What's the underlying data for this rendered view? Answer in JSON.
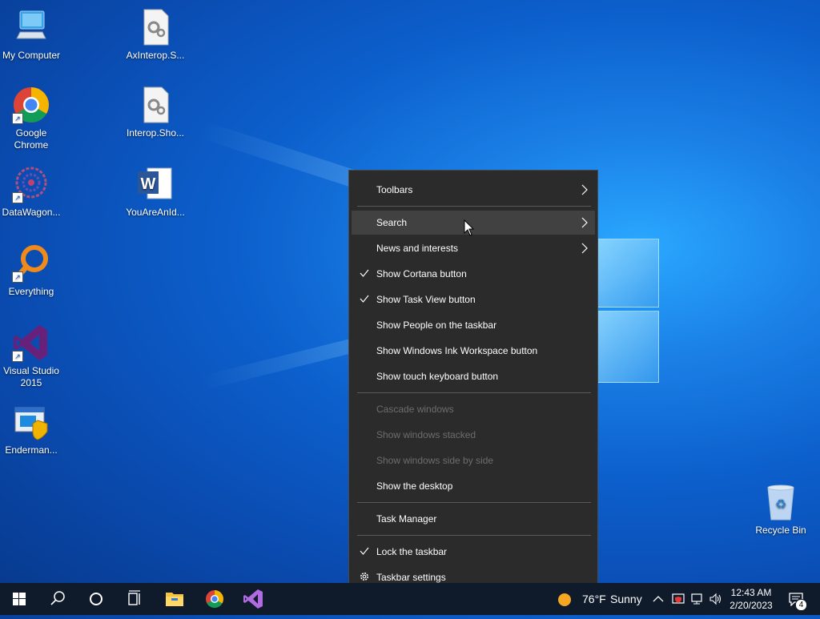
{
  "desktop": {
    "icons": [
      {
        "label": "My Computer",
        "icon": "computer-icon"
      },
      {
        "label": "AxInterop.S...",
        "icon": "dll-file-icon"
      },
      {
        "label": "Google Chrome",
        "icon": "chrome-icon"
      },
      {
        "label": "Interop.Sho...",
        "icon": "dll-file-icon"
      },
      {
        "label": "DataWagon...",
        "icon": "datawagon-icon"
      },
      {
        "label": "YouAreAnId...",
        "icon": "word-document-icon"
      },
      {
        "label": "Everything",
        "icon": "everything-search-icon"
      },
      {
        "label": "Visual Studio 2015",
        "icon": "visual-studio-icon"
      },
      {
        "label": "Enderman...",
        "icon": "installer-icon"
      },
      {
        "label": "Recycle Bin",
        "icon": "recycle-bin-icon"
      }
    ]
  },
  "context_menu": {
    "items": [
      {
        "label": "Toolbars",
        "submenu": true
      },
      {
        "label": "Search",
        "submenu": true
      },
      {
        "label": "News and interests",
        "submenu": true
      },
      {
        "label": "Show Cortana button",
        "checked": true
      },
      {
        "label": "Show Task View button",
        "checked": true
      },
      {
        "label": "Show People on the taskbar"
      },
      {
        "label": "Show Windows Ink Workspace button"
      },
      {
        "label": "Show touch keyboard button"
      },
      {
        "label": "Cascade windows",
        "disabled": true
      },
      {
        "label": "Show windows stacked",
        "disabled": true
      },
      {
        "label": "Show windows side by side",
        "disabled": true
      },
      {
        "label": "Show the desktop"
      },
      {
        "label": "Task Manager"
      },
      {
        "label": "Lock the taskbar",
        "checked": true
      },
      {
        "label": "Taskbar settings",
        "icon": "gear-icon"
      }
    ]
  },
  "taskbar": {
    "pinned": [
      "start-icon",
      "search-icon",
      "cortana-icon",
      "task-view-icon",
      "file-explorer-icon",
      "chrome-icon",
      "visual-studio-icon"
    ],
    "weather": {
      "temp": "76°F",
      "condition": "Sunny"
    },
    "clock": {
      "time": "12:43 AM",
      "date": "2/20/2023"
    },
    "notification_count": "4"
  },
  "colors": {
    "menu_bg": "#2b2b2b",
    "menu_hover": "#414141",
    "taskbar_bg": "#0f1a2b",
    "desktop_blue": "#0c5fcc"
  }
}
